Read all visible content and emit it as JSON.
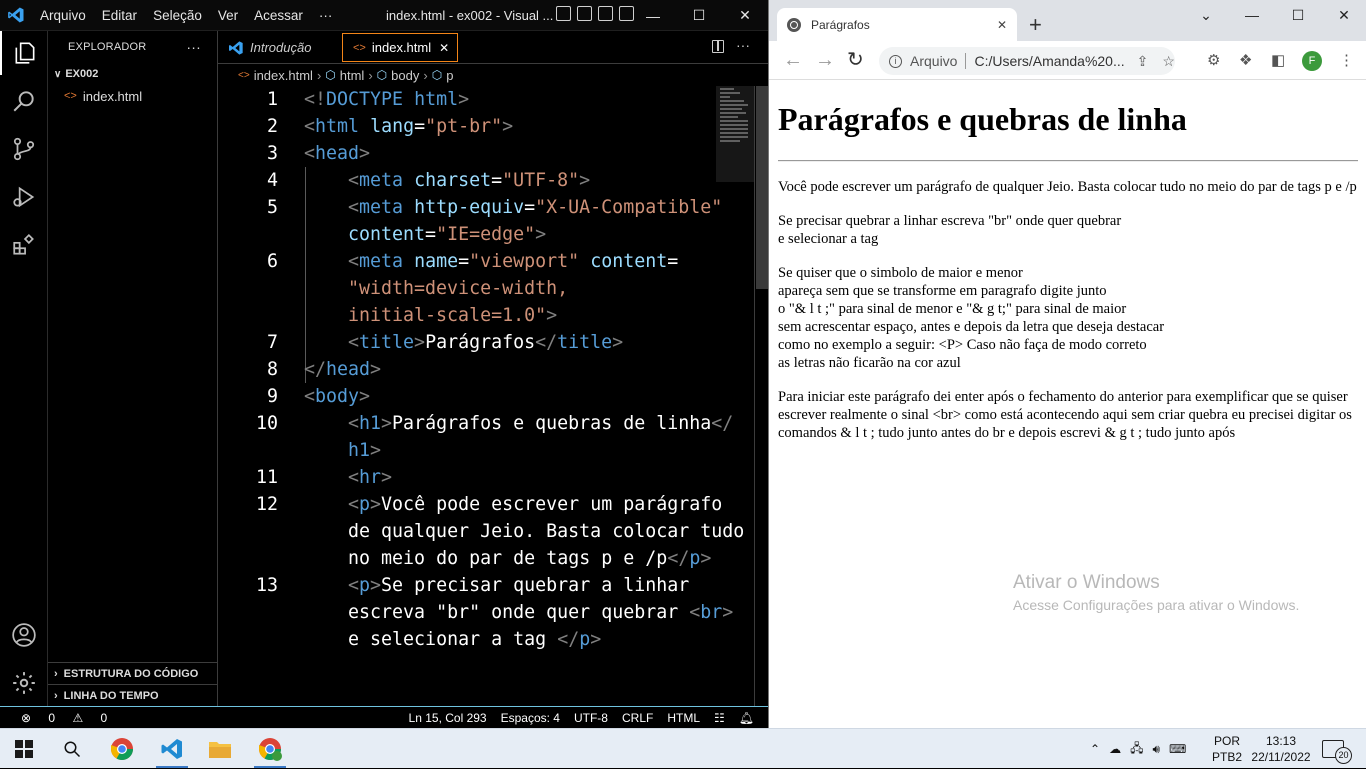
{
  "vscode": {
    "menu": [
      "Arquivo",
      "Editar",
      "Seleção",
      "Ver",
      "Acessar",
      "···"
    ],
    "window_title": "index.html - ex002 - Visual ...",
    "explorer": {
      "title": "EXPLORADOR",
      "more": "···",
      "folder": "EX002",
      "files": [
        "index.html"
      ],
      "sections": [
        "ESTRUTURA DO CÓDIGO",
        "LINHA DO TEMPO"
      ]
    },
    "tabs": [
      {
        "label": "Introdução",
        "italic": true
      },
      {
        "label": "index.html",
        "active": true,
        "close": "✕"
      }
    ],
    "breadcrumbs": [
      "index.html",
      "html",
      "body",
      "p"
    ],
    "code_lines": [
      {
        "num": "1",
        "text": "<!DOCTYPE html>"
      },
      {
        "num": "2",
        "text": "<html lang=\"pt-br\">"
      },
      {
        "num": "3",
        "text": "<head>"
      },
      {
        "num": "4",
        "text": "<meta charset=\"UTF-8\">"
      },
      {
        "num": "5",
        "text": "<meta http-equiv=\"X-UA-Compatible\" content=\"IE=edge\">"
      },
      {
        "num": "6",
        "text": "<meta name=\"viewport\" content=\"width=device-width, initial-scale=1.0\">"
      },
      {
        "num": "7",
        "text": "<title>Parágrafos</title>"
      },
      {
        "num": "8",
        "text": "</head>"
      },
      {
        "num": "9",
        "text": "<body>"
      },
      {
        "num": "10",
        "text": "<h1>Parágrafos e quebras de linha</h1>"
      },
      {
        "num": "11",
        "text": "<hr>"
      },
      {
        "num": "12",
        "text": "<p>Você pode escrever um parágrafo de qualquer Jeio. Basta colocar tudo no meio do par de tags p e /p</p>"
      },
      {
        "num": "13",
        "text": "<p>Se precisar quebrar a linhar escreva \"br\" onde quer quebrar <br> e selecionar a tag </p>"
      }
    ],
    "status": {
      "errors": "0",
      "warnings": "0",
      "position": "Ln 15, Col 293",
      "spaces": "Espaços: 4",
      "encoding": "UTF-8",
      "eol": "CRLF",
      "language": "HTML"
    }
  },
  "chrome": {
    "tab_title": "Parágrafos",
    "tab_close": "✕",
    "new_tab": "+",
    "address_label": "Arquivo",
    "address": "C:/Users/Amanda%20...",
    "profile_letter": "F",
    "page": {
      "heading": "Parágrafos e quebras de linha",
      "paragraphs": [
        [
          "Você pode escrever um parágrafo de qualquer Jeio. Basta colocar tudo no meio do par de tags p e /p"
        ],
        [
          "Se precisar quebrar a linhar escreva \"br\" onde quer quebrar",
          "e selecionar a tag"
        ],
        [
          "Se quiser que o simbolo de maior e menor",
          "apareça sem que se transforme em paragrafo digite junto",
          "o \"& l t ;\" para sinal de menor e \"& g t;\" para sinal de maior",
          "sem acrescentar espaço, antes e depois da letra que deseja destacar",
          "como no exemplo a seguir: <P> Caso não faça de modo correto",
          "as letras não ficarão na cor azul"
        ],
        [
          "Para iniciar este parágrafo dei enter após o fechamento do anterior para exemplificar que se quiser escrever realmente o sinal <br> como está acontecendo aqui sem criar quebra eu precisei digitar os comandos & l t ; tudo junto antes do br e depois escrevi & g t ; tudo junto após"
        ]
      ]
    },
    "watermark": {
      "line1": "Ativar o Windows",
      "line2": "Acesse Configurações para ativar o Windows."
    }
  },
  "taskbar": {
    "language": "POR",
    "layout": "PTB2",
    "time": "13:13",
    "date": "22/11/2022",
    "notifications": "20"
  }
}
